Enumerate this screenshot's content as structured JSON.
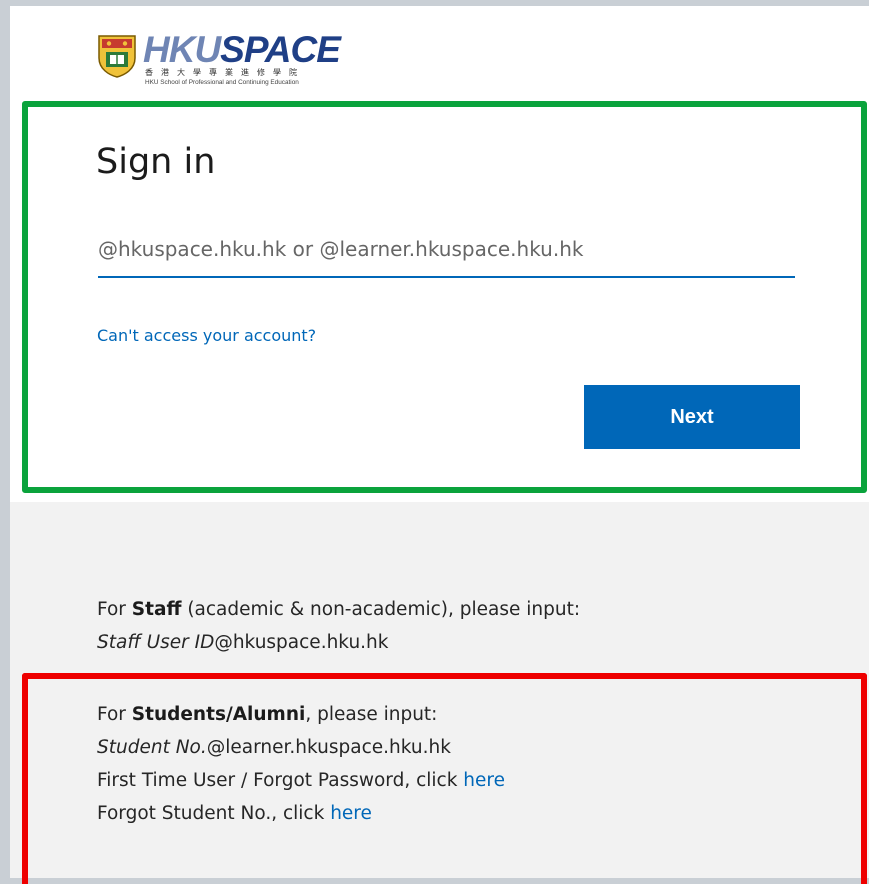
{
  "logo": {
    "brand_hku": "HKU",
    "brand_space": "SPACE",
    "chinese_name": "香港大學專業進修學院",
    "english_name": "HKU School of Professional and Continuing Education"
  },
  "signin": {
    "title": "Sign in",
    "email_placeholder": "@hkuspace.hku.hk or @learner.hkuspace.hku.hk",
    "email_value": "",
    "cant_access_label": "Can't access your account?",
    "next_label": "Next"
  },
  "staff": {
    "prefix": "For ",
    "group": "Staff",
    "suffix": " (academic & non-academic), please input:",
    "id_italic": "Staff User ID",
    "domain": "@hkuspace.hku.hk"
  },
  "students": {
    "prefix": "For ",
    "group": "Students/Alumni",
    "suffix": ", please input:",
    "id_italic": "Student No.",
    "domain": "@learner.hkuspace.hku.hk",
    "first_time_text": "First Time User / Forgot Password, click ",
    "first_time_link": "here",
    "forgot_no_text": "Forgot Student No., click ",
    "forgot_no_link": "here"
  },
  "colors": {
    "accent_blue": "#0067b8",
    "highlight_green": "#0aa33c",
    "highlight_red": "#ee0000"
  }
}
